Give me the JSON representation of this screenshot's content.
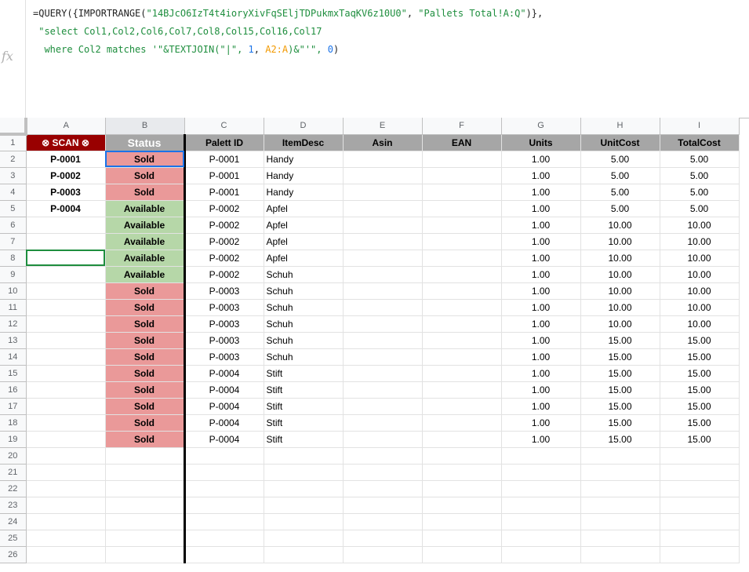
{
  "formula": {
    "line1_prefix": "=QUERY({IMPORTRANGE(",
    "line1_arg1": "\"14BJcO6IzT4t4ioryXivFqSEljTDPukmxTaqKV6z10U0\"",
    "line1_sep": ", ",
    "line1_arg2": "\"Pallets Total!A:Q\"",
    "line1_suffix": ")},",
    "line2": " \"select Col1,Col2,Col6,Col7,Col8,Col15,Col16,Col17",
    "line3_prefix": "  where Col2 matches '\"&TEXTJOIN(\"|\", ",
    "line3_num1": "1",
    "line3_sep": ", ",
    "line3_ref": "A2:A",
    "line3_mid": ")&\"'\", ",
    "line3_num2": "0",
    "line3_suffix": ")",
    "fx_label": "fx"
  },
  "columns": [
    "A",
    "B",
    "C",
    "D",
    "E",
    "F",
    "G",
    "H",
    "I"
  ],
  "header_row": {
    "scan": "⊗ SCAN ⊗",
    "status": "Status",
    "palett_id": "Palett ID",
    "itemdesc": "ItemDesc",
    "asin": "Asin",
    "ean": "EAN",
    "units": "Units",
    "unitcost": "UnitCost",
    "totalcost": "TotalCost"
  },
  "scan_values": [
    "P-0001",
    "P-0002",
    "P-0003",
    "P-0004"
  ],
  "rows": [
    {
      "n": "2",
      "status": "Sold",
      "pid": "P-0001",
      "desc": "Handy",
      "units": "1.00",
      "unit": "5.00",
      "total": "5.00"
    },
    {
      "n": "3",
      "status": "Sold",
      "pid": "P-0001",
      "desc": "Handy",
      "units": "1.00",
      "unit": "5.00",
      "total": "5.00"
    },
    {
      "n": "4",
      "status": "Sold",
      "pid": "P-0001",
      "desc": "Handy",
      "units": "1.00",
      "unit": "5.00",
      "total": "5.00"
    },
    {
      "n": "5",
      "status": "Available",
      "pid": "P-0002",
      "desc": "Apfel",
      "units": "1.00",
      "unit": "5.00",
      "total": "5.00"
    },
    {
      "n": "6",
      "status": "Available",
      "pid": "P-0002",
      "desc": "Apfel",
      "units": "1.00",
      "unit": "10.00",
      "total": "10.00"
    },
    {
      "n": "7",
      "status": "Available",
      "pid": "P-0002",
      "desc": "Apfel",
      "units": "1.00",
      "unit": "10.00",
      "total": "10.00"
    },
    {
      "n": "8",
      "status": "Available",
      "pid": "P-0002",
      "desc": "Apfel",
      "units": "1.00",
      "unit": "10.00",
      "total": "10.00"
    },
    {
      "n": "9",
      "status": "Available",
      "pid": "P-0002",
      "desc": "Schuh",
      "units": "1.00",
      "unit": "10.00",
      "total": "10.00"
    },
    {
      "n": "10",
      "status": "Sold",
      "pid": "P-0003",
      "desc": "Schuh",
      "units": "1.00",
      "unit": "10.00",
      "total": "10.00"
    },
    {
      "n": "11",
      "status": "Sold",
      "pid": "P-0003",
      "desc": "Schuh",
      "units": "1.00",
      "unit": "10.00",
      "total": "10.00"
    },
    {
      "n": "12",
      "status": "Sold",
      "pid": "P-0003",
      "desc": "Schuh",
      "units": "1.00",
      "unit": "10.00",
      "total": "10.00"
    },
    {
      "n": "13",
      "status": "Sold",
      "pid": "P-0003",
      "desc": "Schuh",
      "units": "1.00",
      "unit": "15.00",
      "total": "15.00"
    },
    {
      "n": "14",
      "status": "Sold",
      "pid": "P-0003",
      "desc": "Schuh",
      "units": "1.00",
      "unit": "15.00",
      "total": "15.00"
    },
    {
      "n": "15",
      "status": "Sold",
      "pid": "P-0004",
      "desc": "Stift",
      "units": "1.00",
      "unit": "15.00",
      "total": "15.00"
    },
    {
      "n": "16",
      "status": "Sold",
      "pid": "P-0004",
      "desc": "Stift",
      "units": "1.00",
      "unit": "15.00",
      "total": "15.00"
    },
    {
      "n": "17",
      "status": "Sold",
      "pid": "P-0004",
      "desc": "Stift",
      "units": "1.00",
      "unit": "15.00",
      "total": "15.00"
    },
    {
      "n": "18",
      "status": "Sold",
      "pid": "P-0004",
      "desc": "Stift",
      "units": "1.00",
      "unit": "15.00",
      "total": "15.00"
    },
    {
      "n": "19",
      "status": "Sold",
      "pid": "P-0004",
      "desc": "Stift",
      "units": "1.00",
      "unit": "15.00",
      "total": "15.00"
    }
  ],
  "empty_rows": [
    "20",
    "21",
    "22",
    "23",
    "24",
    "25",
    "26"
  ],
  "colors": {
    "sold": "#ea9999",
    "available": "#b6d7a8",
    "scan_header": "#990000",
    "header_gray": "#a6a6a6"
  }
}
